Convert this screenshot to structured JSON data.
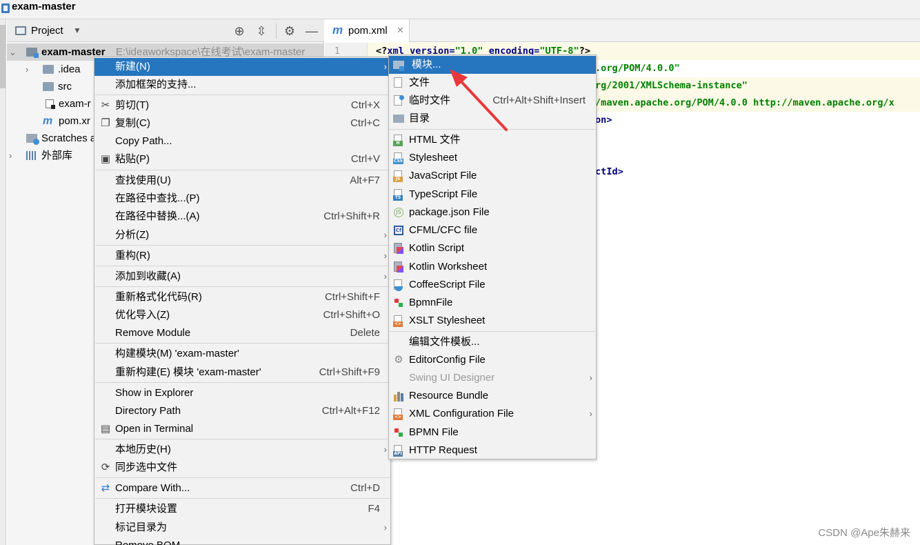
{
  "window": {
    "title": "exam-master"
  },
  "project_panel": {
    "title": "Project",
    "tree": [
      {
        "label": "exam-master",
        "path": "E:\\ideaworkspace\\在线考试\\exam-master",
        "icon": "module-folder-icon"
      },
      {
        "label": ".idea",
        "icon": "folder-icon"
      },
      {
        "label": "src",
        "icon": "folder-icon"
      },
      {
        "label": "exam-r",
        "icon": "iml-file-icon"
      },
      {
        "label": "pom.xr",
        "icon": "maven-icon"
      },
      {
        "label": "Scratches a",
        "icon": "scratches-icon"
      },
      {
        "label": "外部库",
        "icon": "library-icon"
      }
    ]
  },
  "editor": {
    "tab_label": "pom.xml",
    "line_number": "1",
    "code": {
      "l1_pi_open": "<?",
      "l1_tag": "xml version=",
      "l1_v1": "\"1.0\"",
      "l1_attr2": " encoding=",
      "l1_v2": "\"UTF-8\"",
      "l1_pi_close": "?>",
      "l2": ".org/POM/4.0.0\"",
      "l3": "rg/2001/XMLSchema-instance\"",
      "l4": "/maven.apache.org/POM/4.0.0 http://maven.apache.org/x",
      "l5": "on>",
      "l6": "ctId>"
    }
  },
  "context_menu": {
    "items": [
      {
        "label": "新建(N)",
        "shortcut": "",
        "submenu": true
      },
      {
        "label": "添加框架的支持...",
        "shortcut": ""
      },
      {
        "label": "剪切(T)",
        "shortcut": "Ctrl+X",
        "icon": "scissors-icon"
      },
      {
        "label": "复制(C)",
        "shortcut": "Ctrl+C",
        "icon": "copy-icon"
      },
      {
        "label": "Copy Path...",
        "shortcut": ""
      },
      {
        "label": "粘贴(P)",
        "shortcut": "Ctrl+V",
        "icon": "paste-icon"
      },
      {
        "label": "查找使用(U)",
        "shortcut": "Alt+F7"
      },
      {
        "label": "在路径中查找...(P)",
        "shortcut": ""
      },
      {
        "label": "在路径中替换...(A)",
        "shortcut": "Ctrl+Shift+R"
      },
      {
        "label": "分析(Z)",
        "shortcut": "",
        "submenu": true
      },
      {
        "label": "重构(R)",
        "shortcut": "",
        "submenu": true
      },
      {
        "label": "添加到收藏(A)",
        "shortcut": "",
        "submenu": true
      },
      {
        "label": "重新格式化代码(R)",
        "shortcut": "Ctrl+Shift+F"
      },
      {
        "label": "优化导入(Z)",
        "shortcut": "Ctrl+Shift+O"
      },
      {
        "label": "Remove Module",
        "shortcut": "Delete"
      },
      {
        "label": "构建模块(M) 'exam-master'",
        "shortcut": ""
      },
      {
        "label": "重新构建(E) 模块 'exam-master'",
        "shortcut": "Ctrl+Shift+F9"
      },
      {
        "label": "Show in Explorer",
        "shortcut": ""
      },
      {
        "label": "Directory Path",
        "shortcut": "Ctrl+Alt+F12"
      },
      {
        "label": "Open in Terminal",
        "shortcut": "",
        "icon": "terminal-icon"
      },
      {
        "label": "本地历史(H)",
        "shortcut": "",
        "submenu": true
      },
      {
        "label": "同步选中文件",
        "shortcut": "",
        "icon": "sync-icon"
      },
      {
        "label": "Compare With...",
        "shortcut": "Ctrl+D",
        "icon": "compare-icon"
      },
      {
        "label": "打开模块设置",
        "shortcut": "F4"
      },
      {
        "label": "标记目录为",
        "shortcut": "",
        "submenu": true
      },
      {
        "label": "Remove BOM",
        "shortcut": ""
      }
    ]
  },
  "new_submenu": {
    "items": [
      {
        "label": "模块...",
        "icon": "module-icon"
      },
      {
        "label": "文件",
        "icon": "file-icon"
      },
      {
        "label": "临时文件",
        "shortcut": "Ctrl+Alt+Shift+Insert",
        "icon": "scratch-file-icon"
      },
      {
        "label": "目录",
        "icon": "folder-icon"
      },
      {
        "label": "HTML 文件",
        "icon": "html-file-icon",
        "badge": "H",
        "badge_color": "#5aa35a"
      },
      {
        "label": "Stylesheet",
        "icon": "css-file-icon",
        "badge": "CSS",
        "badge_color": "#3d8fd1"
      },
      {
        "label": "JavaScript File",
        "icon": "js-file-icon",
        "badge": "JS",
        "badge_color": "#d9a23a"
      },
      {
        "label": "TypeScript File",
        "icon": "ts-file-icon",
        "badge": "TS",
        "badge_color": "#3a7fc0"
      },
      {
        "label": "package.json File",
        "icon": "nodejs-icon"
      },
      {
        "label": "CFML/CFC file",
        "icon": "cfml-icon"
      },
      {
        "label": "Kotlin Script",
        "icon": "kotlin-icon"
      },
      {
        "label": "Kotlin Worksheet",
        "icon": "kotlin-icon"
      },
      {
        "label": "CoffeeScript File",
        "icon": "coffeescript-icon"
      },
      {
        "label": "BpmnFile",
        "icon": "bpmn-icon"
      },
      {
        "label": "XSLT Stylesheet",
        "icon": "xslt-icon",
        "badge": "<>",
        "badge_color": "#e07a3a"
      },
      {
        "label": "编辑文件模板...",
        "icon": ""
      },
      {
        "label": "EditorConfig File",
        "icon": "gear-icon"
      },
      {
        "label": "Swing UI Designer",
        "icon": "",
        "submenu": true,
        "disabled": true
      },
      {
        "label": "Resource Bundle",
        "icon": "resource-bundle-icon"
      },
      {
        "label": "XML Configuration File",
        "icon": "xml-icon",
        "submenu": true,
        "badge": "<>",
        "badge_color": "#e07a3a"
      },
      {
        "label": "BPMN File",
        "icon": "bpmn-icon"
      },
      {
        "label": "HTTP Request",
        "icon": "api-icon",
        "badge": "API",
        "badge_color": "#5a7ea8"
      }
    ]
  },
  "watermark": "CSDN @Ape朱赫来",
  "colors": {
    "accent": "#2675bf",
    "annotation_arrow": "#e8383a"
  }
}
